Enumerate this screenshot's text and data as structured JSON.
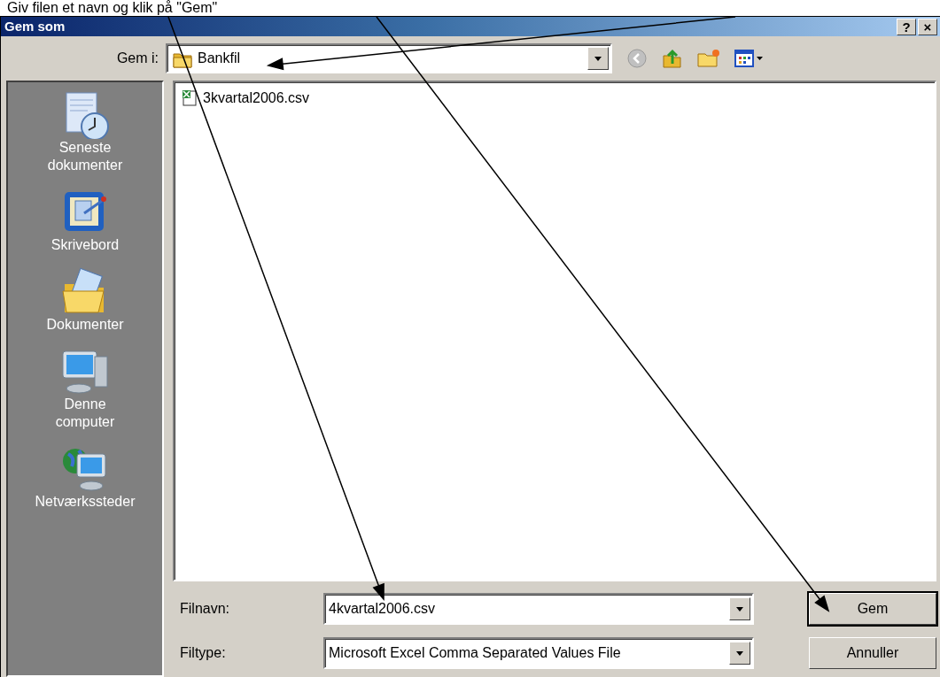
{
  "caption": "Giv filen et navn og klik på \"Gem\"",
  "window": {
    "title": "Gem som",
    "buttons": [
      "?",
      "×"
    ]
  },
  "save_in": {
    "label": "Gem i:",
    "value": "Bankfil"
  },
  "places": [
    {
      "kind": "recent",
      "label": "Seneste\ndokumenter"
    },
    {
      "kind": "desktop",
      "label": "Skrivebord"
    },
    {
      "kind": "documents",
      "label": "Dokumenter"
    },
    {
      "kind": "computer",
      "label": "Denne\ncomputer"
    },
    {
      "kind": "network",
      "label": "Netværkssteder"
    }
  ],
  "files": [
    {
      "name": "3kvartal2006.csv"
    }
  ],
  "filename": {
    "label": "Filnavn:",
    "value": "4kvartal2006.csv"
  },
  "filetype": {
    "label": "Filtype:",
    "value": "Microsoft Excel Comma Separated Values File"
  },
  "buttons": [
    {
      "label": "Gem",
      "default": true
    },
    {
      "label": "Annuller",
      "default": false
    }
  ]
}
